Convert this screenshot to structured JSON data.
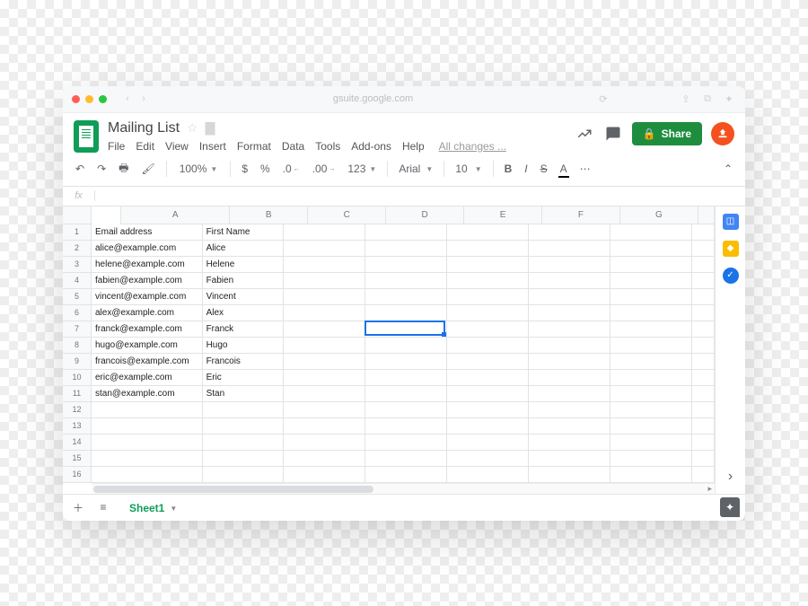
{
  "browser": {
    "url": "gsuite.google.com"
  },
  "doc": {
    "title": "Mailing List",
    "saved": "All changes ...",
    "share": "Share"
  },
  "menus": [
    "File",
    "Edit",
    "View",
    "Insert",
    "Format",
    "Data",
    "Tools",
    "Add-ons",
    "Help"
  ],
  "toolbar": {
    "zoom": "100%",
    "currency": "$",
    "percent": "%",
    "dec_less": ".0",
    "dec_more": ".00",
    "numfmt": "123",
    "font": "Arial",
    "fontsize": "10",
    "bold": "B",
    "italic": "I",
    "strike": "S",
    "textcolor": "A",
    "more": "⋯"
  },
  "fx": "fx",
  "columns": [
    "A",
    "B",
    "C",
    "D",
    "E",
    "F",
    "G"
  ],
  "row_count": 16,
  "selected": {
    "row": 7,
    "col": "D"
  },
  "rows": [
    {
      "A": "Email address",
      "B": "First Name"
    },
    {
      "A": "alice@example.com",
      "B": "Alice"
    },
    {
      "A": "helene@example.com",
      "B": "Helene"
    },
    {
      "A": "fabien@example.com",
      "B": "Fabien"
    },
    {
      "A": "vincent@example.com",
      "B": "Vincent"
    },
    {
      "A": "alex@example.com",
      "B": "Alex"
    },
    {
      "A": "franck@example.com",
      "B": "Franck"
    },
    {
      "A": "hugo@example.com",
      "B": "Hugo"
    },
    {
      "A": "francois@example.com",
      "B": "Francois"
    },
    {
      "A": "eric@example.com",
      "B": "Eric"
    },
    {
      "A": "stan@example.com",
      "B": "Stan"
    }
  ],
  "sheet_tab": "Sheet1"
}
